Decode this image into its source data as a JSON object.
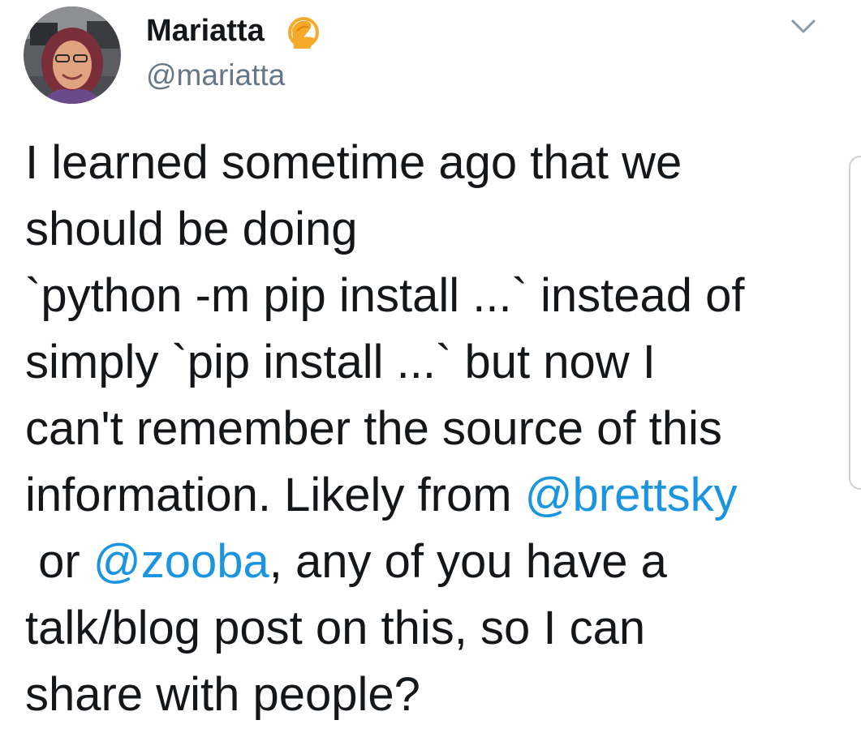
{
  "author": {
    "display_name": "Mariatta",
    "handle": "@mariatta",
    "badge_icon": "face-palm-emoji-icon",
    "badge_color": "#f7a92a"
  },
  "tweet": {
    "lines": [
      "I learned sometime ago that we",
      "should be doing",
      "`python -m pip install ...` instead of",
      "simply `pip install ...` but now I",
      "can't remember the source of this",
      "information. Likely from ",
      " or ",
      "talk/blog post on this, so I can",
      "share with people?"
    ],
    "mention_1": "@brettsky",
    "mention_2": "@zooba",
    "after_mention_2": ", any of you have a"
  },
  "menu": {
    "icon": "chevron-down-icon"
  },
  "colors": {
    "text": "#14171a",
    "secondary": "#657786",
    "link": "#1b95e0"
  }
}
